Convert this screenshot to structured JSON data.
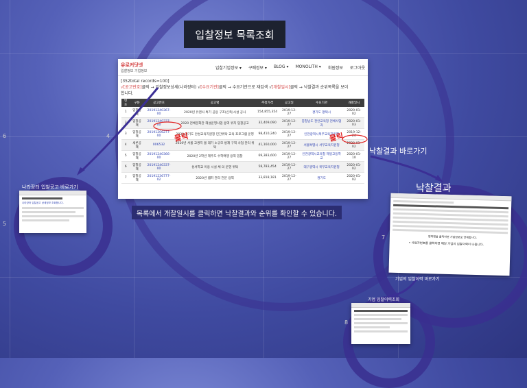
{
  "title": "입찰정보 목록조회",
  "main": {
    "logo_name": "유로커닷넷",
    "logo_sub": "입찰정보 기업정보",
    "menu": [
      "입찰기업정보 ▾",
      "구매정보 ▾",
      "BLOG ▾",
      "MONOLITH ▾",
      "회원정보",
      "로그아웃"
    ],
    "records": "[352total records=100]",
    "desc_a": "√[공고번호]",
    "desc_b": "클릭 → 입찰정보상세(나라장터) √",
    "desc_c": "[수요기관]",
    "desc_d": "클릭 → 수요기관으로 재검색 √",
    "desc_e": "[개찰일시]",
    "desc_f": "클릭 → 낙찰결과 순위목록을 보이",
    "desc_g": "합니다.",
    "headers": [
      "번호",
      "구분",
      "공고번호",
      "공고명",
      "추정가격",
      "공고일",
      "수요기관",
      "개찰일시"
    ],
    "rows": [
      [
        "1",
        "입찰공책",
        "20191240367-00",
        "2020년 유엔사 특기 공용 구조(신축)시설 공사",
        "154,855,354",
        "2019-12-27",
        "경기도 평택시",
        "2020-01-02"
      ],
      [
        "2",
        "입찰공책",
        "20191240337-00",
        "2020 천체문화관 해설운영사업 용역 위치 입찰공고",
        "32,409,090",
        "2019-12-27",
        "충청남도 천안교육청 천체사업과",
        "2020-01-03"
      ],
      [
        "3",
        "입찰공책",
        "20191206277-00",
        "2020 경기도 안성교육지원청 민간위탁 교육 프로그램 운영",
        "98,410,240",
        "2019-12-27",
        "인천광역시북부교육지원청",
        "2019-12-24"
      ],
      [
        "4",
        "새론공책",
        "006532",
        "2020년 서울 고경지 물 대기 소규모 방재 구역 사업 관리 위탁",
        "41,160,000",
        "2019-12-27",
        "서울특별시 서부교육지원청",
        "2020-01-02"
      ],
      [
        "5",
        "입찰공책",
        "20191240366-00",
        "2020년 2학년 제주도 수학여행 용역 입찰",
        "69,383,600",
        "2019-12-27",
        "인천광역시교육청 제일고등학교",
        "2020-01-10"
      ],
      [
        "6",
        "입찰공책",
        "20191240337-00",
        "성서학교 이용 시설 체 의 운영 위탁",
        "58,783,454",
        "2019-12-27",
        "대구광역시 북부교육지원청",
        "2020-01-02"
      ],
      [
        "7",
        "입찰공책",
        "20191236777-02",
        "2020년 캠퍼 관리 전문 용역",
        "33,818,181",
        "2019-12-27",
        "경기도",
        "2020-01-02"
      ]
    ]
  },
  "caption": "목록에서 개찰일시를 클릭하면 낙찰결과와 순위를 확인할 수 있습니다.",
  "hand_click": "클릭",
  "labels": {
    "left_thumb": "나라장터 입찰공고 바로가기",
    "right_arrow": "낙찰결과 바로가기",
    "right_title": "낙찰결과",
    "right_caption": "업체명을 클릭하면 기업정보로 연계합니다.",
    "right_bullet": "• 사업자번호를 클릭하면 해당 기업의 입찰이력이 나옵니다.",
    "bottom_arrow": "기업의 입찰이력 바로가기",
    "bottom_thumb": "기업 입찰이력조회",
    "left_thumb_caption": "나라장터 입찰공고 상세정보 조회합니다."
  },
  "slide_numbers": [
    "6",
    "4",
    "5",
    "7",
    "8"
  ]
}
